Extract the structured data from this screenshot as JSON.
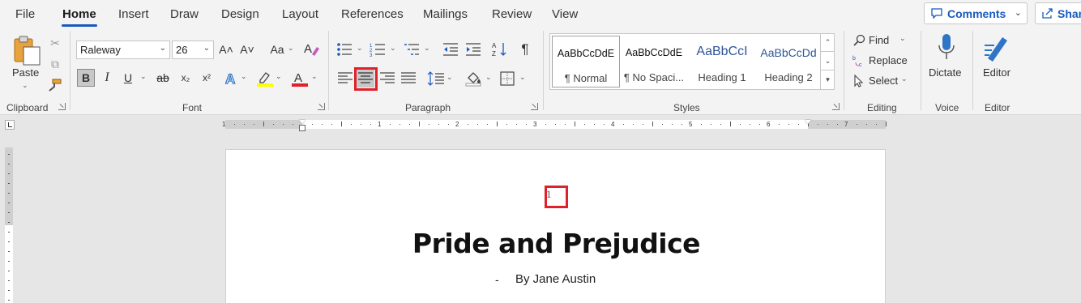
{
  "tabs": [
    "File",
    "Home",
    "Insert",
    "Draw",
    "Design",
    "Layout",
    "References",
    "Mailings",
    "Review",
    "View"
  ],
  "active_tab": "Home",
  "header_buttons": {
    "comments": "Comments",
    "share": "Shar"
  },
  "clipboard": {
    "paste": "Paste",
    "label": "Clipboard"
  },
  "font": {
    "name": "Raleway",
    "size": "26",
    "label": "Font",
    "grow": "A˄",
    "shrink": "A˅",
    "case": "Aa",
    "bold": "B",
    "italic": "I",
    "underline": "U",
    "strike": "ab",
    "subscript": "x₂",
    "superscript": "x²",
    "highlight_color": "#ffff00",
    "font_color": "#e0202a"
  },
  "paragraph": {
    "label": "Paragraph",
    "pilcrow": "¶"
  },
  "styles": {
    "label": "Styles",
    "items": [
      {
        "preview": "AaBbCcDdE",
        "name": "¶ Normal"
      },
      {
        "preview": "AaBbCcDdE",
        "name": "¶ No Spaci..."
      },
      {
        "preview": "AaBbCcI",
        "name": "Heading 1"
      },
      {
        "preview": "AaBbCcDd",
        "name": "Heading 2"
      }
    ]
  },
  "editing": {
    "find": "Find",
    "replace": "Replace",
    "select": "Select",
    "label": "Editing"
  },
  "voice": {
    "dictate": "Dictate",
    "label": "Voice"
  },
  "editor": {
    "editor": "Editor",
    "label": "Editor"
  },
  "ruler_numbers": [
    "1",
    "1",
    "2",
    "3",
    "4",
    "5",
    "6",
    "7"
  ],
  "document": {
    "page_number": "1",
    "title": "Pride and Prejudice",
    "dash": "-",
    "byline": "By Jane Austin"
  },
  "colors": {
    "accent": "#185abd",
    "highlight_box": "#e0202a"
  }
}
